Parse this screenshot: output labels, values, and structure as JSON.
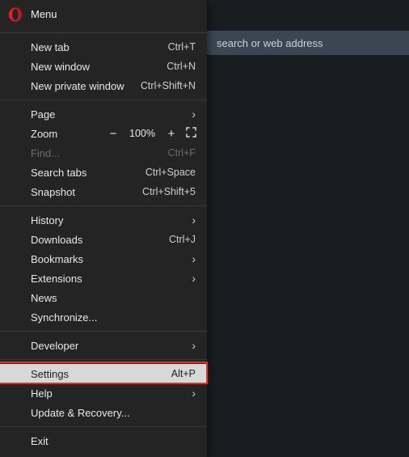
{
  "address_bar": {
    "placeholder": "search or web address"
  },
  "menu": {
    "title": "Menu",
    "items": {
      "new_tab": {
        "label": "New tab",
        "shortcut": "Ctrl+T"
      },
      "new_window": {
        "label": "New window",
        "shortcut": "Ctrl+N"
      },
      "new_private": {
        "label": "New private window",
        "shortcut": "Ctrl+Shift+N"
      },
      "page": {
        "label": "Page"
      },
      "zoom": {
        "label": "Zoom",
        "minus": "−",
        "percent": "100%",
        "plus": "+"
      },
      "find": {
        "label": "Find...",
        "shortcut": "Ctrl+F"
      },
      "search_tabs": {
        "label": "Search tabs",
        "shortcut": "Ctrl+Space"
      },
      "snapshot": {
        "label": "Snapshot",
        "shortcut": "Ctrl+Shift+5"
      },
      "history": {
        "label": "History"
      },
      "downloads": {
        "label": "Downloads",
        "shortcut": "Ctrl+J"
      },
      "bookmarks": {
        "label": "Bookmarks"
      },
      "extensions": {
        "label": "Extensions"
      },
      "news": {
        "label": "News"
      },
      "synchronize": {
        "label": "Synchronize..."
      },
      "developer": {
        "label": "Developer"
      },
      "settings": {
        "label": "Settings",
        "shortcut": "Alt+P"
      },
      "help": {
        "label": "Help"
      },
      "update": {
        "label": "Update & Recovery..."
      },
      "exit": {
        "label": "Exit"
      }
    }
  }
}
